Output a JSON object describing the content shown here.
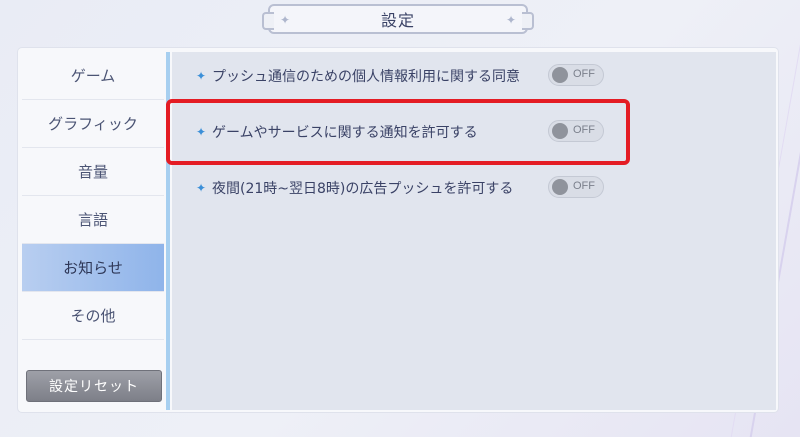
{
  "header": {
    "title": "設定"
  },
  "corner_label": "",
  "sidebar": {
    "items": [
      {
        "label": "ゲーム"
      },
      {
        "label": "グラフィック"
      },
      {
        "label": "音量"
      },
      {
        "label": "言語"
      },
      {
        "label": "お知らせ",
        "selected": true
      },
      {
        "label": "その他"
      }
    ],
    "reset_label": "設定リセット"
  },
  "settings": [
    {
      "label": "プッシュ通信のための個人情報利用に関する同意",
      "toggle": "OFF"
    },
    {
      "label": "ゲームやサービスに関する通知を許可する",
      "toggle": "OFF"
    },
    {
      "label": "夜間(21時~翌日8時)の広告プッシュを許可する",
      "toggle": "OFF"
    }
  ],
  "colors": {
    "accent": "#8fb4ea",
    "highlight": "#e41c24",
    "bullet": "#3b8fd8",
    "text": "#3a4266"
  },
  "icons": {
    "bullet": "sparkle-icon",
    "title_ornament": "star-icon"
  }
}
